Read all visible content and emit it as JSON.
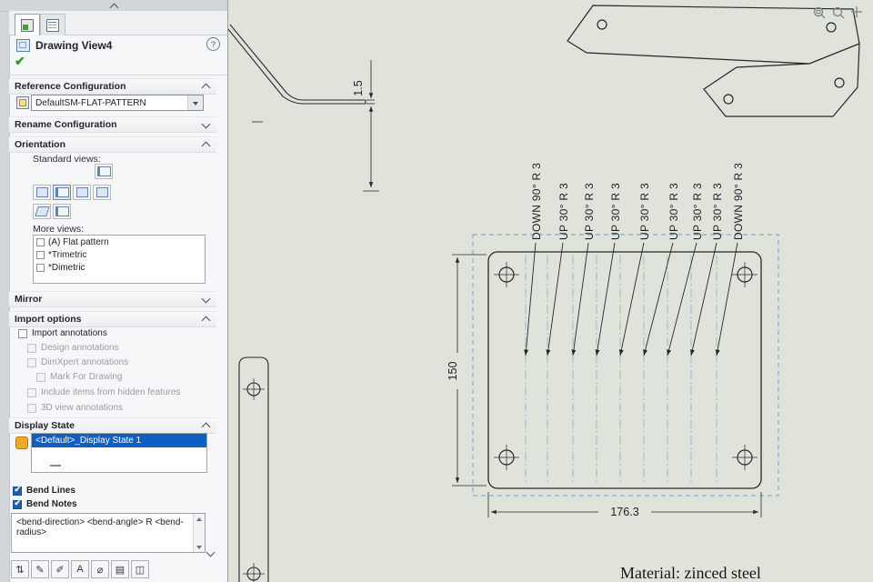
{
  "panel": {
    "title": "Drawing View4",
    "help": "?",
    "reference_configuration": {
      "header": "Reference Configuration",
      "value": "DefaultSM-FLAT-PATTERN"
    },
    "rename_configuration": {
      "header": "Rename Configuration"
    },
    "orientation": {
      "header": "Orientation",
      "standard_views_label": "Standard views:",
      "more_views_label": "More views:",
      "more_views": [
        "(A) Flat pattern",
        "*Trimetric",
        "*Dimetric"
      ]
    },
    "mirror": {
      "header": "Mirror"
    },
    "import_options": {
      "header": "Import options",
      "items": [
        {
          "label": "Import annotations"
        },
        {
          "label": "Design annotations"
        },
        {
          "label": "DimXpert annotations"
        },
        {
          "label": "Mark For Drawing"
        },
        {
          "label": "Include items from hidden features"
        },
        {
          "label": "3D view annotations"
        }
      ]
    },
    "display_state": {
      "header": "Display State",
      "selected_item": "<Default>_Display State 1"
    },
    "bend_lines_label": "Bend Lines",
    "bend_notes_label": "Bend Notes",
    "bend_note_format": "<bend-direction>  <bend-angle> R <bend-radius>",
    "toolbar": {
      "icons": [
        {
          "name": "flip-order-icon",
          "glyph": "⇅"
        },
        {
          "name": "edit-note-icon",
          "glyph": "✎"
        },
        {
          "name": "edit-leader-icon",
          "glyph": "✐"
        },
        {
          "name": "text-format-icon",
          "glyph": "A"
        },
        {
          "name": "diameter-symbol-icon",
          "glyph": "⌀"
        },
        {
          "name": "layer-icon",
          "glyph": "▤"
        },
        {
          "name": "copy-format-icon",
          "glyph": "◫"
        }
      ]
    }
  },
  "drawing": {
    "dims": {
      "thickness": "1.5",
      "height": "150",
      "width": "176.3"
    },
    "bend_notes": [
      "DOWN 90° R 3",
      "UP 30° R 3",
      "UP 30° R 3",
      "UP 30° R 3",
      "UP 30° R 3",
      "UP 30° R 3",
      "UP 30° R 3",
      "UP 30° R 3",
      "DOWN 90° R 3"
    ],
    "material_note": "Material: zinced steel"
  },
  "colors": {
    "accent_blue": "#1b5fae",
    "selection_blue": "#0e5fc1",
    "sheet": "#e0e3da"
  }
}
